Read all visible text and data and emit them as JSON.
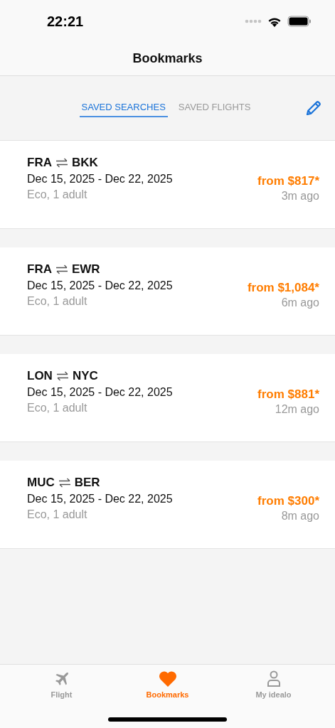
{
  "status_bar": {
    "time": "22:21"
  },
  "nav": {
    "title": "Bookmarks"
  },
  "tabs": [
    {
      "label": "SAVED SEARCHES",
      "selected": true
    },
    {
      "label": "SAVED FLIGHTS",
      "selected": false
    }
  ],
  "searches": [
    {
      "origin": "FRA",
      "destination": "BKK",
      "dates": "Dec 15, 2025 - Dec 22, 2025",
      "details": "Eco, 1 adult",
      "price": "from $817*",
      "age": "3m ago"
    },
    {
      "origin": "FRA",
      "destination": "EWR",
      "dates": "Dec 15, 2025 - Dec 22, 2025",
      "details": "Eco, 1 adult",
      "price": "from $1,084*",
      "age": "6m ago"
    },
    {
      "origin": "LON",
      "destination": "NYC",
      "dates": "Dec 15, 2025 - Dec 22, 2025",
      "details": "Eco, 1 adult",
      "price": "from $881*",
      "age": "12m ago"
    },
    {
      "origin": "MUC",
      "destination": "BER",
      "dates": "Dec 15, 2025 - Dec 22, 2025",
      "details": "Eco, 1 adult",
      "price": "from $300*",
      "age": "8m ago"
    }
  ],
  "tab_bar": [
    {
      "label": "Flight",
      "kind": "flight",
      "selected": false
    },
    {
      "label": "Bookmarks",
      "kind": "bookmarks",
      "selected": true
    },
    {
      "label": "My idealo",
      "kind": "profile",
      "selected": false
    }
  ]
}
